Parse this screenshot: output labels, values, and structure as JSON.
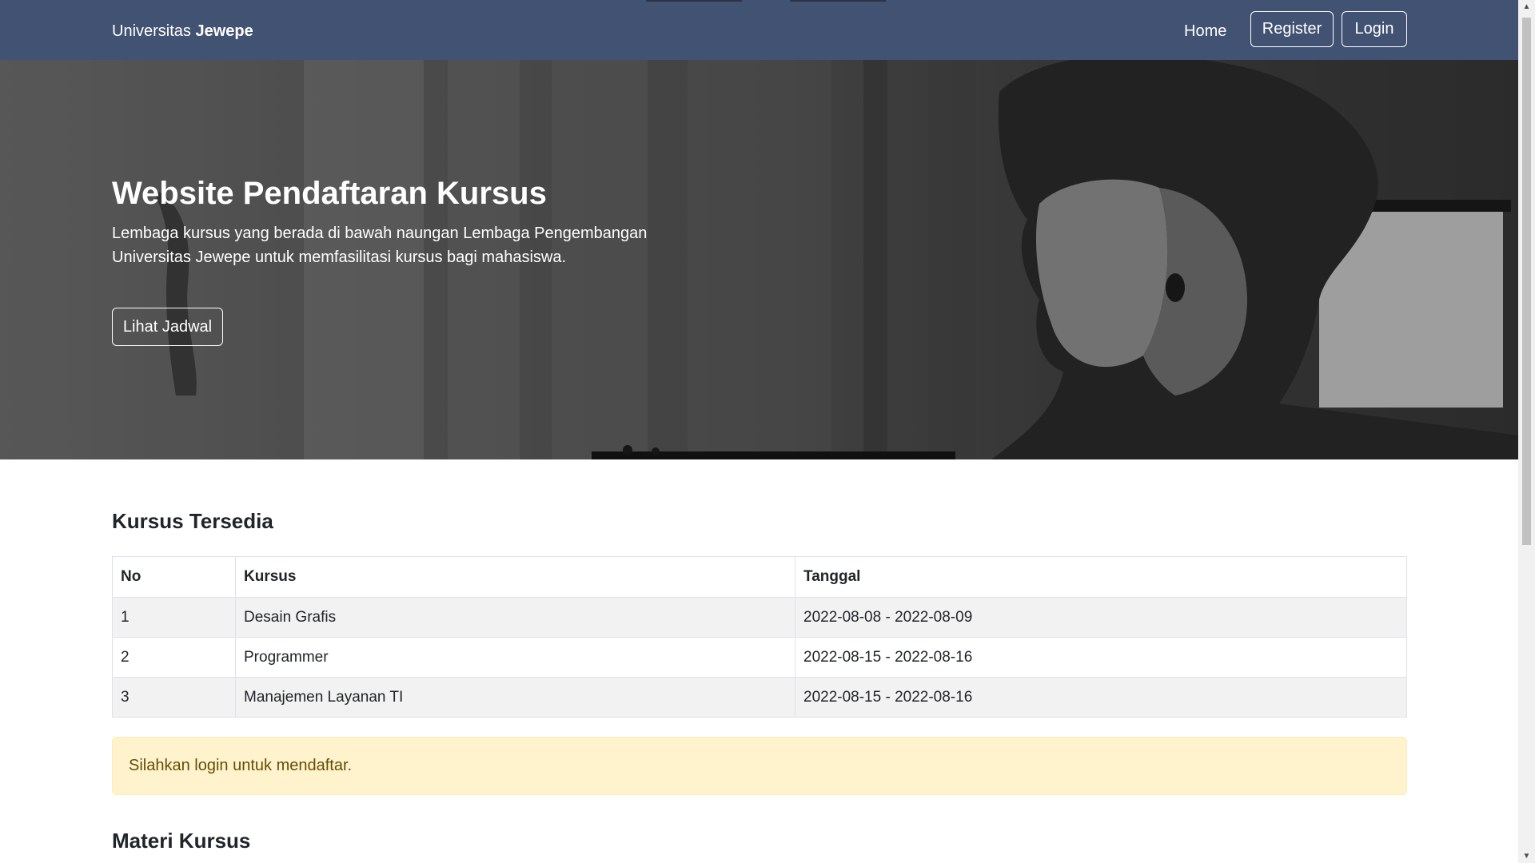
{
  "navbar": {
    "brand_prefix": "Universitas",
    "brand_bold": "Jewepe",
    "links": {
      "home": "Home"
    },
    "buttons": {
      "register": "Register",
      "login": "Login"
    },
    "background": "#425273"
  },
  "hero": {
    "title": "Website Pendaftaran Kursus",
    "subtitle": "Lembaga kursus yang berada di bawah naungan Lembaga Pengembangan Universitas Jewepe untuk memfasilitasi kursus bagi mahasiswa.",
    "cta_label": "Lihat Jadwal"
  },
  "courses": {
    "heading": "Kursus Tersedia",
    "columns": [
      "No",
      "Kursus",
      "Tanggal"
    ],
    "rows": [
      [
        "1",
        "Desain Grafis",
        "2022-08-08 - 2022-08-09"
      ],
      [
        "2",
        "Programmer",
        "2022-08-15 - 2022-08-16"
      ],
      [
        "3",
        "Manajemen Layanan TI",
        "2022-08-15 - 2022-08-16"
      ]
    ]
  },
  "alert": {
    "text": "Silahkan login untuk mendaftar.",
    "background": "#fff3cd"
  },
  "materials": {
    "heading": "Materi Kursus"
  },
  "icons": {
    "scroll_up": "chevron-up-icon",
    "scroll_down": "chevron-down-icon"
  }
}
